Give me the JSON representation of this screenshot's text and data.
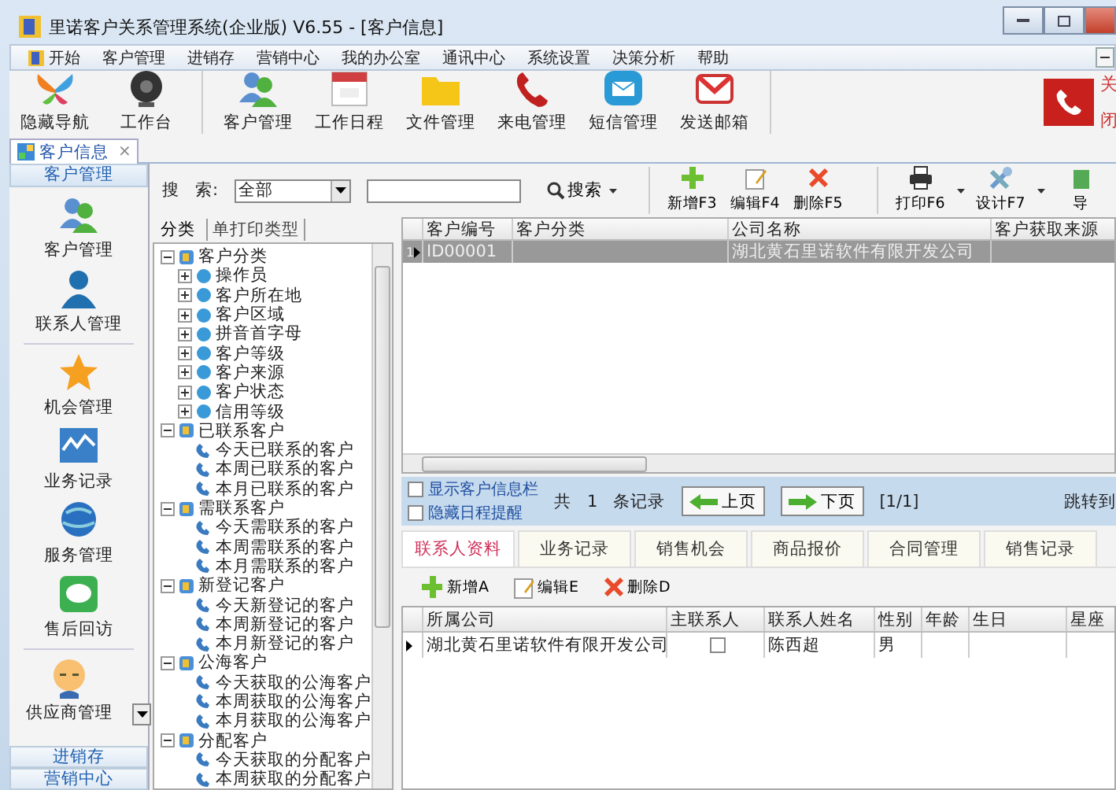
{
  "window": {
    "title": "里诺客户关系管理系统(企业版) V6.55 - [客户信息]"
  },
  "menu": [
    "开始",
    "客户管理",
    "进销存",
    "营销中心",
    "我的办公室",
    "通讯中心",
    "系统设置",
    "决策分析",
    "帮助"
  ],
  "toolbar_groups": [
    [
      "隐藏导航",
      "工作台"
    ],
    [
      "客户管理",
      "工作日程",
      "文件管理",
      "来电管理",
      "短信管理",
      "发送邮箱"
    ]
  ],
  "phone_panel": {
    "line_1": "关",
    "line_2": "闭"
  },
  "document_tabs": [
    {
      "label": "客户信息",
      "selected": true,
      "close": "×"
    }
  ],
  "nav": {
    "header": "客户管理",
    "items": [
      "客户管理",
      "联系人管理",
      "机会管理",
      "业务记录",
      "服务管理",
      "售后回访",
      "供应商管理"
    ],
    "footer_buttons": [
      "进销存",
      "营销中心"
    ]
  },
  "search": {
    "label_1": "搜",
    "label_2": "索:",
    "scope": "全部",
    "button": "搜索"
  },
  "actions": [
    [
      {
        "label": "新增F3",
        "dropdown": false
      },
      {
        "label": "编辑F4",
        "dropdown": false
      },
      {
        "label": "删除F5",
        "dropdown": false
      }
    ],
    [
      {
        "label": "打印F6",
        "dropdown": true
      },
      {
        "label": "设计F7",
        "dropdown": true
      },
      {
        "label": "导",
        "dropdown": false
      }
    ]
  ],
  "tree_tabs": [
    {
      "label": "分类",
      "selected": true
    },
    {
      "label": "单打印类型",
      "selected": false
    }
  ],
  "tree": [
    {
      "label": "客户分类",
      "expanded": true,
      "children": [
        {
          "label": "操作员",
          "expanded": false
        },
        {
          "label": "客户所在地",
          "expanded": false
        },
        {
          "label": "客户区域",
          "expanded": false
        },
        {
          "label": "拼音首字母",
          "expanded": false
        },
        {
          "label": "客户等级",
          "expanded": false
        },
        {
          "label": "客户来源",
          "expanded": false
        },
        {
          "label": "客户状态",
          "expanded": false
        },
        {
          "label": "信用等级",
          "expanded": false
        }
      ]
    },
    {
      "label": "已联系客户",
      "expanded": true,
      "children": [
        {
          "label": "今天已联系的客户"
        },
        {
          "label": "本周已联系的客户"
        },
        {
          "label": "本月已联系的客户"
        }
      ]
    },
    {
      "label": "需联系客户",
      "expanded": true,
      "children": [
        {
          "label": "今天需联系的客户"
        },
        {
          "label": "本周需联系的客户"
        },
        {
          "label": "本月需联系的客户"
        }
      ]
    },
    {
      "label": "新登记客户",
      "expanded": true,
      "children": [
        {
          "label": "今天新登记的客户"
        },
        {
          "label": "本周新登记的客户"
        },
        {
          "label": "本月新登记的客户"
        }
      ]
    },
    {
      "label": "公海客户",
      "expanded": true,
      "children": [
        {
          "label": "今天获取的公海客户"
        },
        {
          "label": "本周获取的公海客户"
        },
        {
          "label": "本月获取的公海客户"
        }
      ]
    },
    {
      "label": "分配客户",
      "expanded": true,
      "children": [
        {
          "label": "今天获取的分配客户"
        },
        {
          "label": "本周获取的分配客户"
        }
      ]
    }
  ],
  "customer_table": {
    "columns": [
      "客户编号",
      "客户分类",
      "公司名称",
      "客户获取来源"
    ],
    "rows": [
      {
        "number": "1",
        "selected": true,
        "cells": [
          "ID00001",
          "",
          "湖北黄石里诺软件有限开发公司",
          ""
        ]
      }
    ]
  },
  "pager": {
    "options": [
      {
        "label": "显示客户信息栏",
        "checked": false
      },
      {
        "label": "隐藏日程提醒",
        "checked": false
      }
    ],
    "total_prefix": "共",
    "total": "1",
    "total_suffix": "条记录",
    "prev": "上页",
    "next": "下页",
    "page": "[1/1]",
    "jump": "跳转到"
  },
  "detail_tabs": [
    {
      "label": "联系人资料",
      "selected": true
    },
    {
      "label": "业务记录",
      "selected": false
    },
    {
      "label": "销售机会",
      "selected": false
    },
    {
      "label": "商品报价",
      "selected": false
    },
    {
      "label": "合同管理",
      "selected": false
    },
    {
      "label": "销售记录",
      "selected": false
    }
  ],
  "detail_actions": [
    "新增A",
    "编辑E",
    "删除D"
  ],
  "contact_table": {
    "columns": [
      "所属公司",
      "主联系人",
      "联系人姓名",
      "性别",
      "年龄",
      "生日",
      "星座"
    ],
    "rows": [
      {
        "company": "湖北黄石里诺软件有限开发公司",
        "primary_contact": false,
        "name": "陈西超",
        "gender": "男"
      }
    ]
  }
}
